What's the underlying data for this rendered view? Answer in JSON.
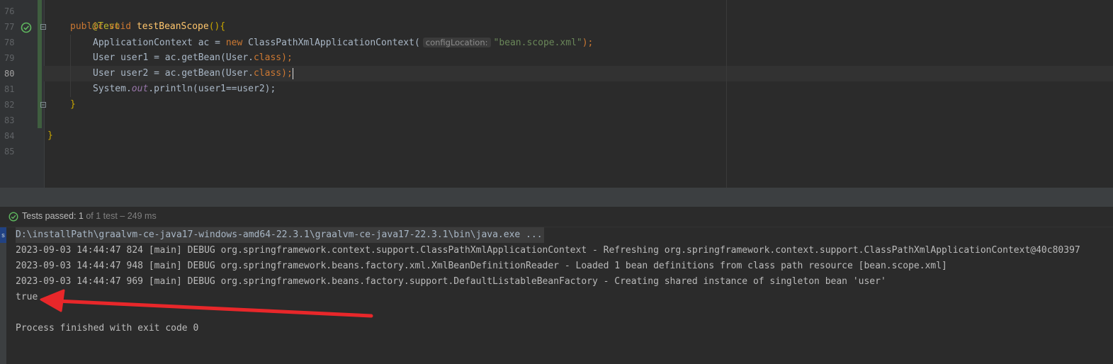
{
  "editor": {
    "line_numbers": [
      "76",
      "77",
      "78",
      "79",
      "80",
      "81",
      "82",
      "83",
      "84",
      "85"
    ],
    "current_line": "80",
    "lines": {
      "l76_annotation": "@Test",
      "l77_kw_public": "public",
      "l77_kw_void": "void",
      "l77_method": "testBeanScope",
      "l77_rest": "(){",
      "l78_type": "ApplicationContext ac = ",
      "l78_kw_new": "new",
      "l78_ctor": " ClassPathXmlApplicationContext(",
      "l78_hint": "configLocation:",
      "l78_str": "\"bean.scope.xml\"",
      "l78_end": ");",
      "l79_a": "User user1 = ac.getBean(User.",
      "l79_kw": "class",
      "l79_end": ");",
      "l80_a": "User user2 = ac.getBean(User.",
      "l80_kw": "class",
      "l80_end": ");",
      "l81_a": "System.",
      "l81_field": "out",
      "l81_b": ".println(user1==user2);",
      "l82_brace": "}",
      "l84_brace": "}"
    }
  },
  "test_status": {
    "label": "Tests passed:",
    "count": "1",
    "detail": "of 1 test – 249 ms"
  },
  "console": {
    "side_tab": "s",
    "command": "D:\\installPath\\graalvm-ce-java17-windows-amd64-22.3.1\\graalvm-ce-java17-22.3.1\\bin\\java.exe ...",
    "log_lines": [
      "2023-09-03 14:44:47 824 [main] DEBUG org.springframework.context.support.ClassPathXmlApplicationContext - Refreshing org.springframework.context.support.ClassPathXmlApplicationContext@40c80397",
      "2023-09-03 14:44:47 948 [main] DEBUG org.springframework.beans.factory.xml.XmlBeanDefinitionReader - Loaded 1 bean definitions from class path resource [bean.scope.xml]",
      "2023-09-03 14:44:47 969 [main] DEBUG org.springframework.beans.factory.support.DefaultListableBeanFactory - Creating shared instance of singleton bean 'user'"
    ],
    "result": "true",
    "exit_message": "Process finished with exit code 0"
  },
  "colors": {
    "arrow": "#e8272a",
    "pass_green": "#5fb85f",
    "keyword": "#cc7832",
    "string": "#6a8759"
  },
  "icons": {
    "run_marker": "passed-check-icon",
    "status": "check-circle-icon",
    "annotation_arrow": "red-arrow"
  }
}
